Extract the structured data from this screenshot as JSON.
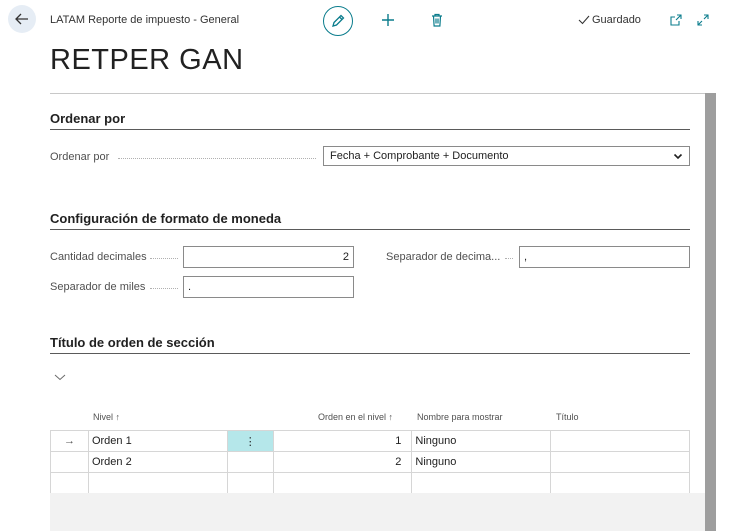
{
  "header": {
    "breadcrumb": "LATAM Reporte de impuesto - General",
    "saved_label": "Guardado",
    "title": "RETPER GAN"
  },
  "sections": {
    "order": {
      "title": "Ordenar por",
      "field_label": "Ordenar por",
      "field_value": "Fecha + Comprobante + Documento"
    },
    "currency": {
      "title": "Configuración de formato de moneda",
      "decimals_label": "Cantidad decimales",
      "decimals_value": "2",
      "decimal_sep_label": "Separador de decima...",
      "decimal_sep_value": ",",
      "thousands_label": "Separador de miles",
      "thousands_value": "."
    },
    "section_order": {
      "title": "Título de orden de sección",
      "columns": {
        "level": "Nivel ↑",
        "order_in_level": "Orden en el nivel ↑",
        "display_name": "Nombre para mostrar",
        "title": "Título"
      },
      "rows": [
        {
          "level": "Orden 1",
          "menu": "⋮",
          "order": "1",
          "display_name": "Ninguno",
          "title": "",
          "arrow": "→"
        },
        {
          "level": "Orden 2",
          "menu": "",
          "order": "2",
          "display_name": "Ninguno",
          "title": "",
          "arrow": ""
        }
      ]
    }
  },
  "colors": {
    "accent": "#0a7c8c",
    "selected_cell": "#b5e7ea",
    "back_button_bg": "#e6edf5"
  },
  "icons": {
    "back": "arrow-left-icon",
    "edit": "pencil-icon",
    "add": "plus-icon",
    "delete": "trash-icon",
    "saved": "check-icon",
    "open_new": "open-in-new-window-icon",
    "expand": "expand-icon"
  }
}
